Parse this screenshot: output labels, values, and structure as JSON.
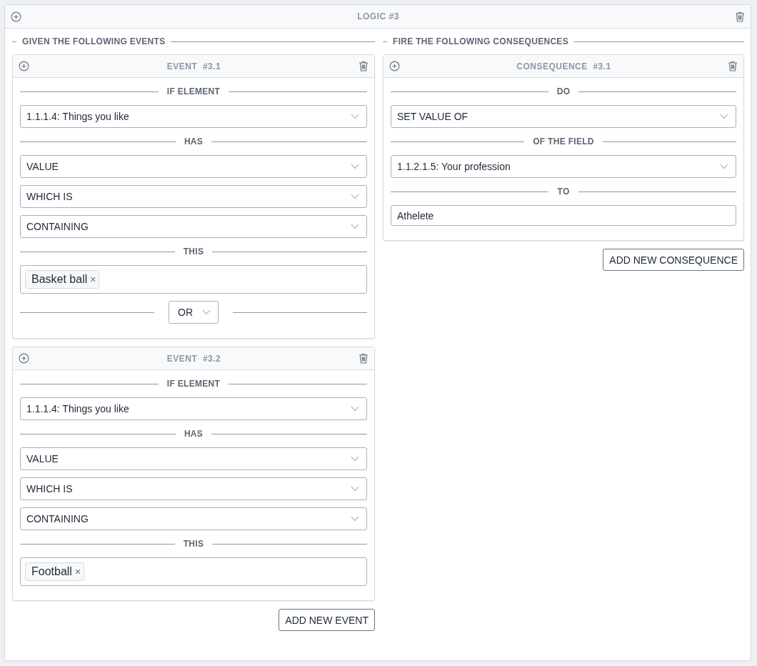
{
  "logic": {
    "title": "LOGIC #3"
  },
  "events_section": {
    "title": "GIVEN THE FOLLOWING EVENTS",
    "add_button": "ADD NEW EVENT"
  },
  "events": [
    {
      "title": "EVENT  #3.1",
      "rows": [
        {
          "kind": "heading",
          "text": "IF ELEMENT"
        },
        {
          "kind": "select",
          "value": "1.1.1.4: Things you like"
        },
        {
          "kind": "heading",
          "text": "HAS"
        },
        {
          "kind": "select",
          "value": "VALUE"
        },
        {
          "kind": "select",
          "value": "WHICH IS"
        },
        {
          "kind": "select",
          "value": "CONTAINING"
        },
        {
          "kind": "heading",
          "text": "THIS"
        },
        {
          "kind": "tags",
          "tags": [
            {
              "label": "Basket ball",
              "remove": "×"
            }
          ]
        },
        {
          "kind": "connector",
          "value": "OR"
        }
      ]
    },
    {
      "title": "EVENT  #3.2",
      "rows": [
        {
          "kind": "heading",
          "text": "IF ELEMENT"
        },
        {
          "kind": "select",
          "value": "1.1.1.4: Things you like"
        },
        {
          "kind": "heading",
          "text": "HAS"
        },
        {
          "kind": "select",
          "value": "VALUE"
        },
        {
          "kind": "select",
          "value": "WHICH IS"
        },
        {
          "kind": "select",
          "value": "CONTAINING"
        },
        {
          "kind": "heading",
          "text": "THIS"
        },
        {
          "kind": "tags",
          "tags": [
            {
              "label": "Football",
              "remove": "×"
            }
          ]
        }
      ]
    }
  ],
  "consequences_section": {
    "title": "FIRE THE FOLLOWING CONSEQUENCES",
    "add_button": "ADD NEW CONSEQUENCE"
  },
  "consequences": [
    {
      "title": "CONSEQUENCE  #3.1",
      "rows": [
        {
          "kind": "heading",
          "text": "DO"
        },
        {
          "kind": "select",
          "value": "SET VALUE OF"
        },
        {
          "kind": "heading",
          "text": "OF THE FIELD"
        },
        {
          "kind": "select",
          "value": "1.1.2.1.5: Your profession"
        },
        {
          "kind": "heading",
          "text": "TO"
        },
        {
          "kind": "input",
          "value": "Athelete"
        }
      ]
    }
  ]
}
